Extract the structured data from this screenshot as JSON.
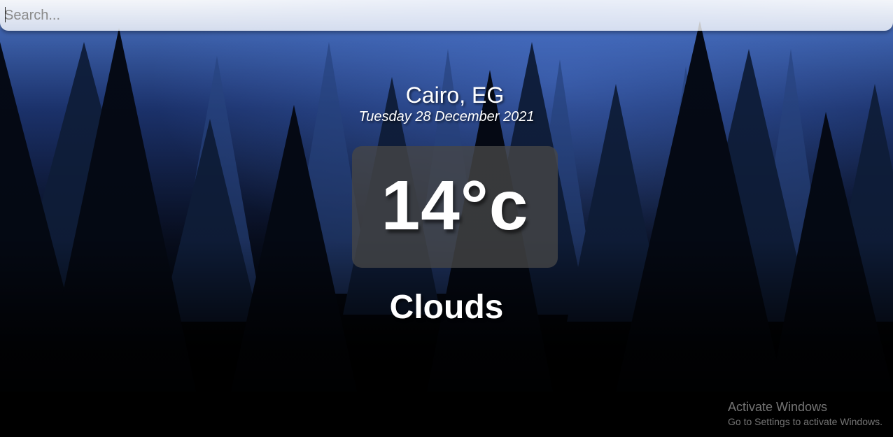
{
  "search": {
    "placeholder": "Search..."
  },
  "location": {
    "city": "Cairo, EG",
    "date": "Tuesday 28 December 2021"
  },
  "weather": {
    "temperature": "14°c",
    "condition": "Clouds"
  },
  "windows_watermark": {
    "title": "Activate Windows",
    "subtitle": "Go to Settings to activate Windows."
  },
  "colors": {
    "sky_top": "#3a5ea8",
    "forest_dark": "#0a1226",
    "temp_box": "#464646",
    "text": "#ffffff"
  }
}
